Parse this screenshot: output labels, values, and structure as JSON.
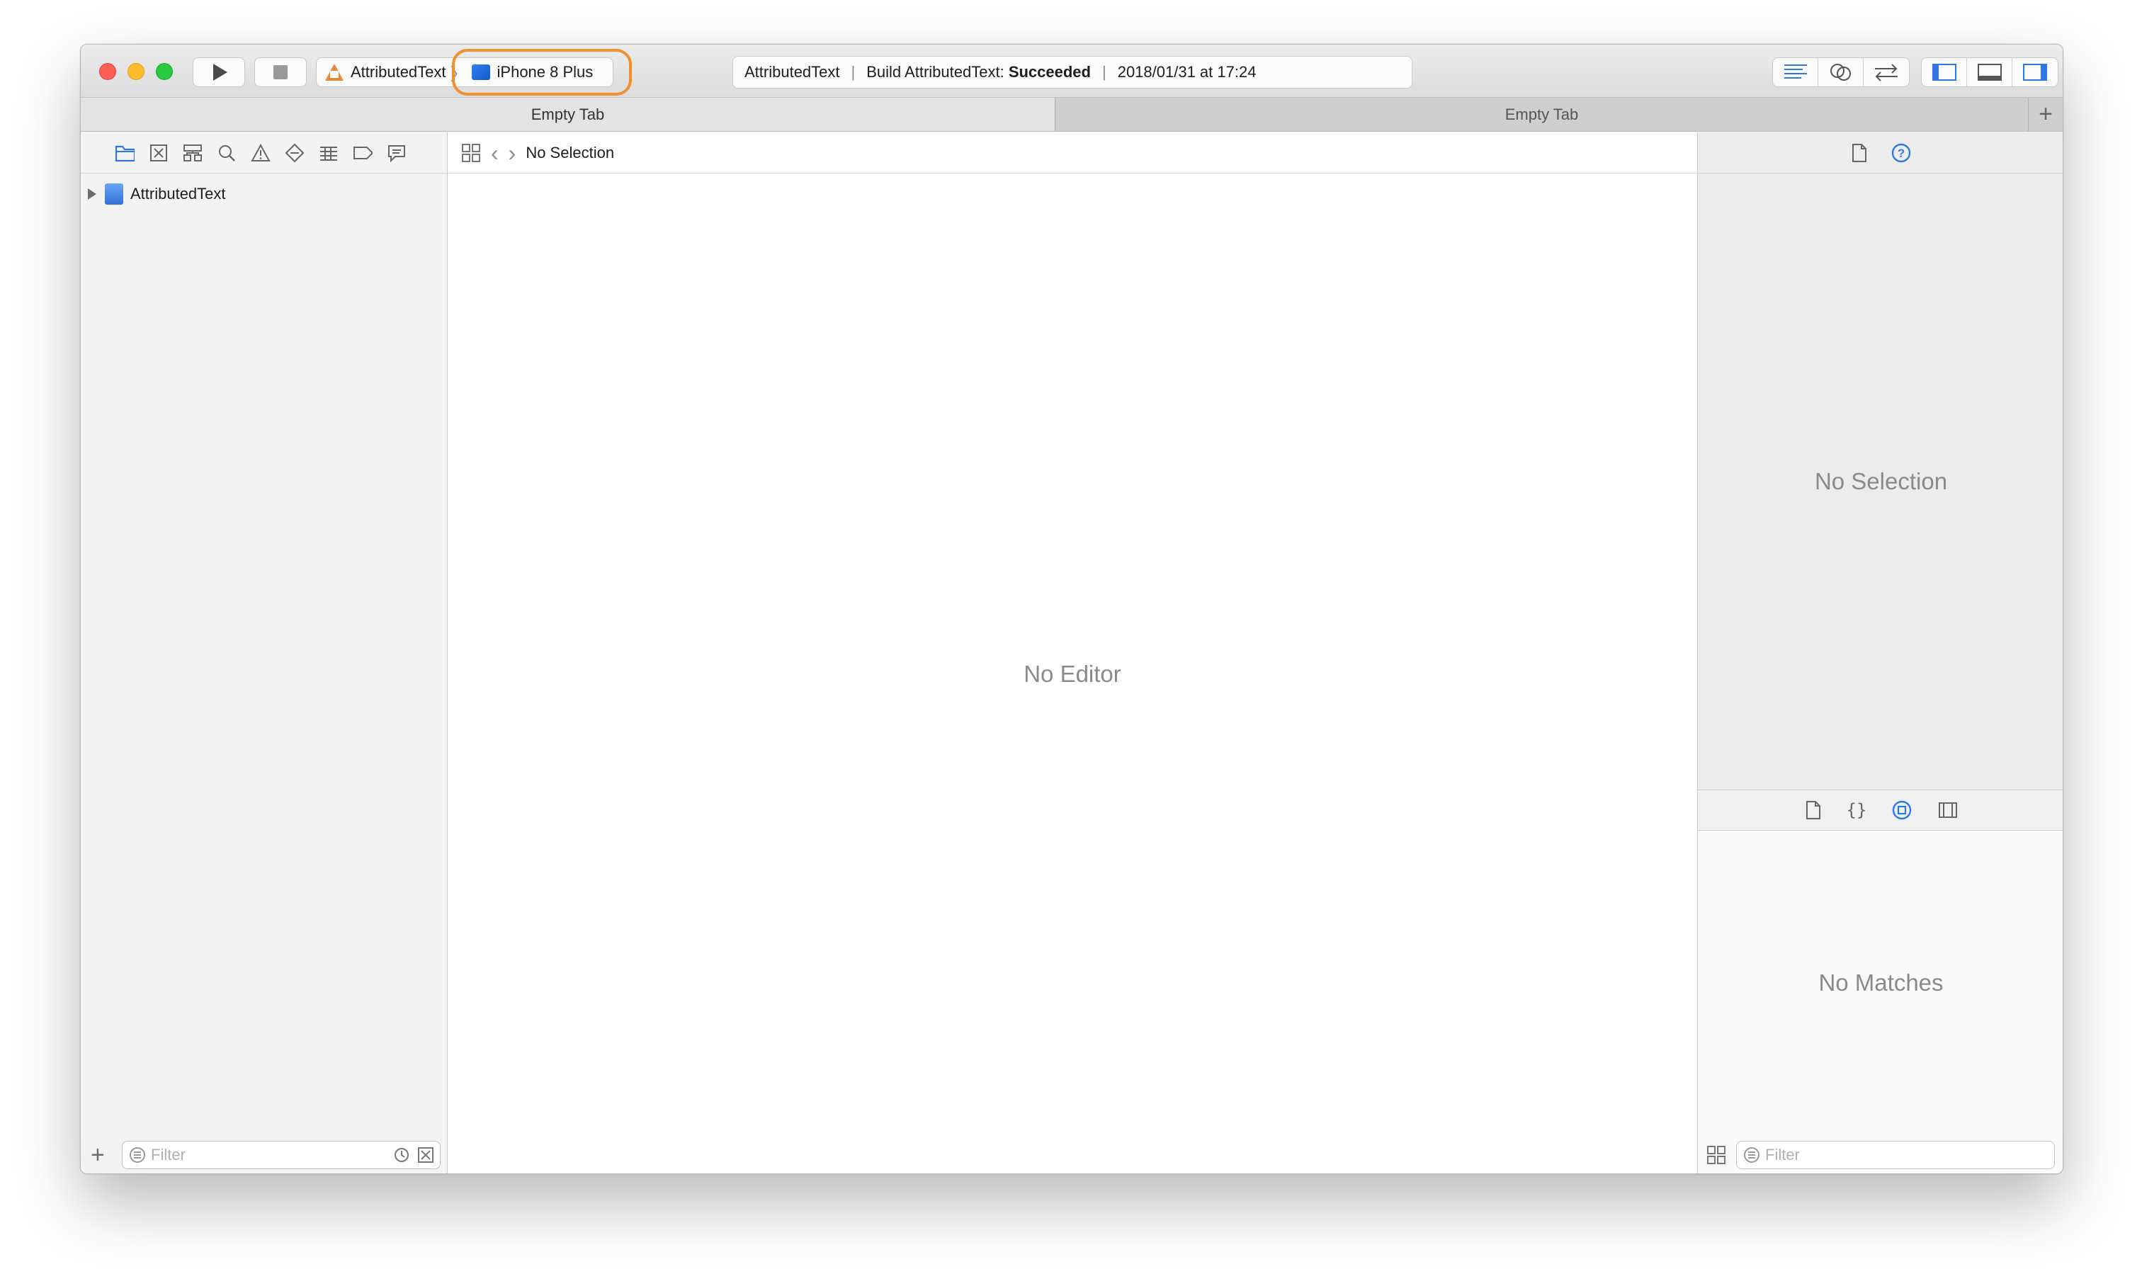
{
  "toolbar": {
    "scheme_name": "AttributedText",
    "device_name": "iPhone 8 Plus",
    "activity_project": "AttributedText",
    "activity_build_prefix": "Build AttributedText:",
    "activity_status": "Succeeded",
    "activity_timestamp": "2018/01/31 at 17:24",
    "highlight_color": "#f0902e"
  },
  "tabs": [
    {
      "label": "Empty Tab",
      "active": true
    },
    {
      "label": "Empty Tab",
      "active": false
    }
  ],
  "navigator": {
    "tree_items": [
      {
        "label": "AttributedText"
      }
    ],
    "filter_placeholder": "Filter"
  },
  "editor": {
    "jumpbar_label": "No Selection",
    "empty_message": "No Editor"
  },
  "inspector": {
    "empty_message": "No Selection",
    "library_empty_message": "No Matches",
    "filter_placeholder": "Filter"
  },
  "icons": {
    "toolbar": [
      "run-icon",
      "stop-icon",
      "standard-editor-icon",
      "assistant-editor-icon",
      "version-editor-icon",
      "navigator-toggle-icon",
      "debug-area-toggle-icon",
      "utilities-toggle-icon"
    ],
    "navigator_tabs": [
      "project-navigator-icon",
      "source-control-icon",
      "symbol-navigator-icon",
      "find-icon",
      "issue-icon",
      "test-icon",
      "debug-icon",
      "breakpoint-icon",
      "report-icon"
    ],
    "inspector_tabs": [
      "file-inspector-icon",
      "quick-help-icon"
    ],
    "library_tabs": [
      "file-template-icon",
      "code-snippet-icon",
      "object-library-icon",
      "media-library-icon"
    ]
  }
}
